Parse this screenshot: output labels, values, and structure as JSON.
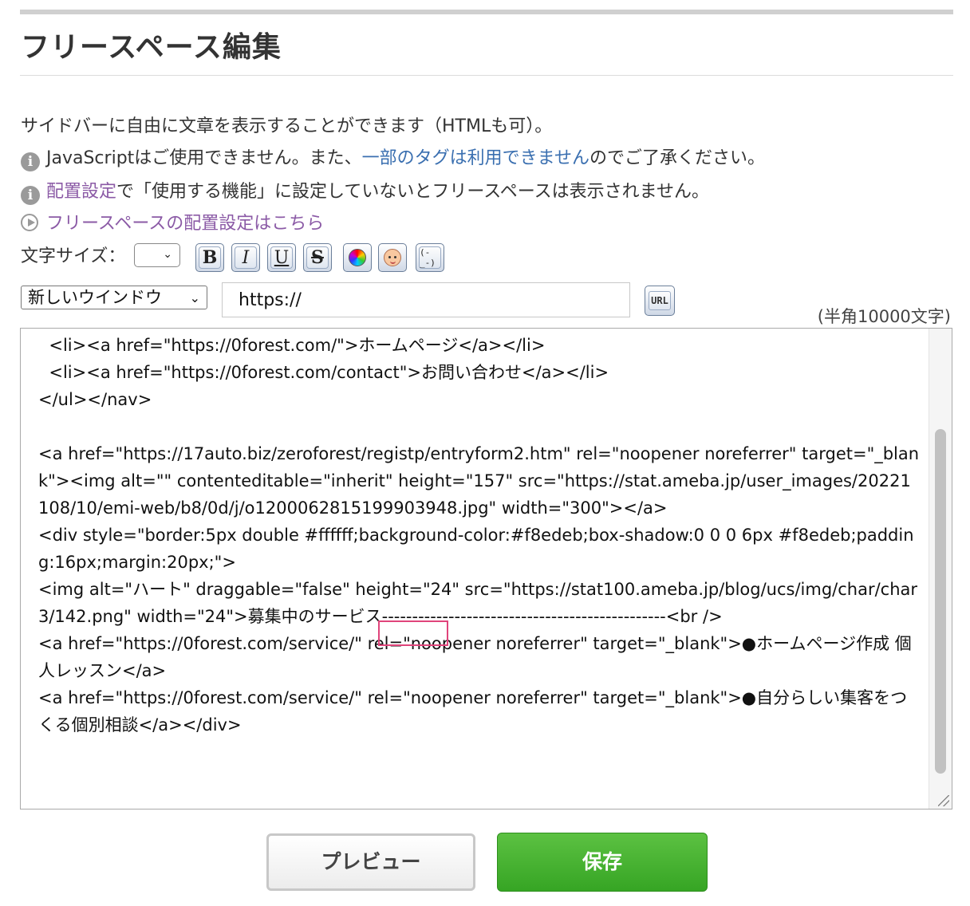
{
  "header": {
    "title": "フリースペース編集"
  },
  "intro": {
    "description": "サイドバーに自由に文章を表示することができます（HTMLも可）。",
    "notice1_before": "JavaScriptはご使用できません。また、",
    "notice1_link": "一部のタグは利用できません",
    "notice1_after": "のでご了承ください。",
    "notice2_link": "配置設定",
    "notice2_after": "で「使用する機能」に設定していないとフリースペースは表示されません。",
    "placement_link": "フリースペースの配置設定はこちら"
  },
  "toolbar": {
    "font_size_label": "文字サイズ：",
    "font_size_value": "",
    "bold_label": "B",
    "italic_label": "I",
    "underline_label": "U",
    "strike_label": "S",
    "emoji_label": "(-_-)",
    "icons": [
      "bold-icon",
      "italic-icon",
      "underline-icon",
      "strikethrough-icon",
      "color-palette-icon",
      "face-icon",
      "emoticon-icon"
    ]
  },
  "link": {
    "target_option": "新しいウインドウ",
    "url_value": "https://",
    "url_button_label": "URL"
  },
  "editor": {
    "char_limit": "(半角10000文字)",
    "content": "  <li><a href=\"https://0forest.com/\">ホームページ</a></li>\n  <li><a href=\"https://0forest.com/contact\">お問い合わせ</a></li>\n</ul></nav>\n\n<a href=\"https://17auto.biz/zeroforest/registp/entryform2.htm\" rel=\"noopener noreferrer\" target=\"_blank\"><img alt=\"\" contenteditable=\"inherit\" height=\"157\" src=\"https://stat.ameba.jp/user_images/20221108/10/emi-web/b8/0d/j/o1200062815199903948.jpg\" width=\"300\"></a>\n<div style=\"border:5px double #ffffff;background-color:#f8edeb;box-shadow:0 0 0 6px #f8edeb;padding:16px;margin:20px;\">\n<img alt=\"ハート\" draggable=\"false\" height=\"24\" src=\"https://stat100.ameba.jp/blog/ucs/img/char/char3/142.png\" width=\"24\">募集中のサービス-----------------------------------------------<br />\n<a href=\"https://0forest.com/service/\" rel=\"noopener noreferrer\" target=\"_blank\">●ホームページ作成 個人レッスン</a>\n<a href=\"https://0forest.com/service/\" rel=\"noopener noreferrer\" target=\"_blank\">●自分らしい集客をつくる個別相談</a></div>"
  },
  "actions": {
    "preview_label": "プレビュー",
    "save_label": "保存"
  },
  "colors": {
    "save_green": "#3fae2a",
    "link_blue": "#3a6fb0",
    "link_purple": "#8b5aa6",
    "highlight_pink": "#e0457b"
  }
}
